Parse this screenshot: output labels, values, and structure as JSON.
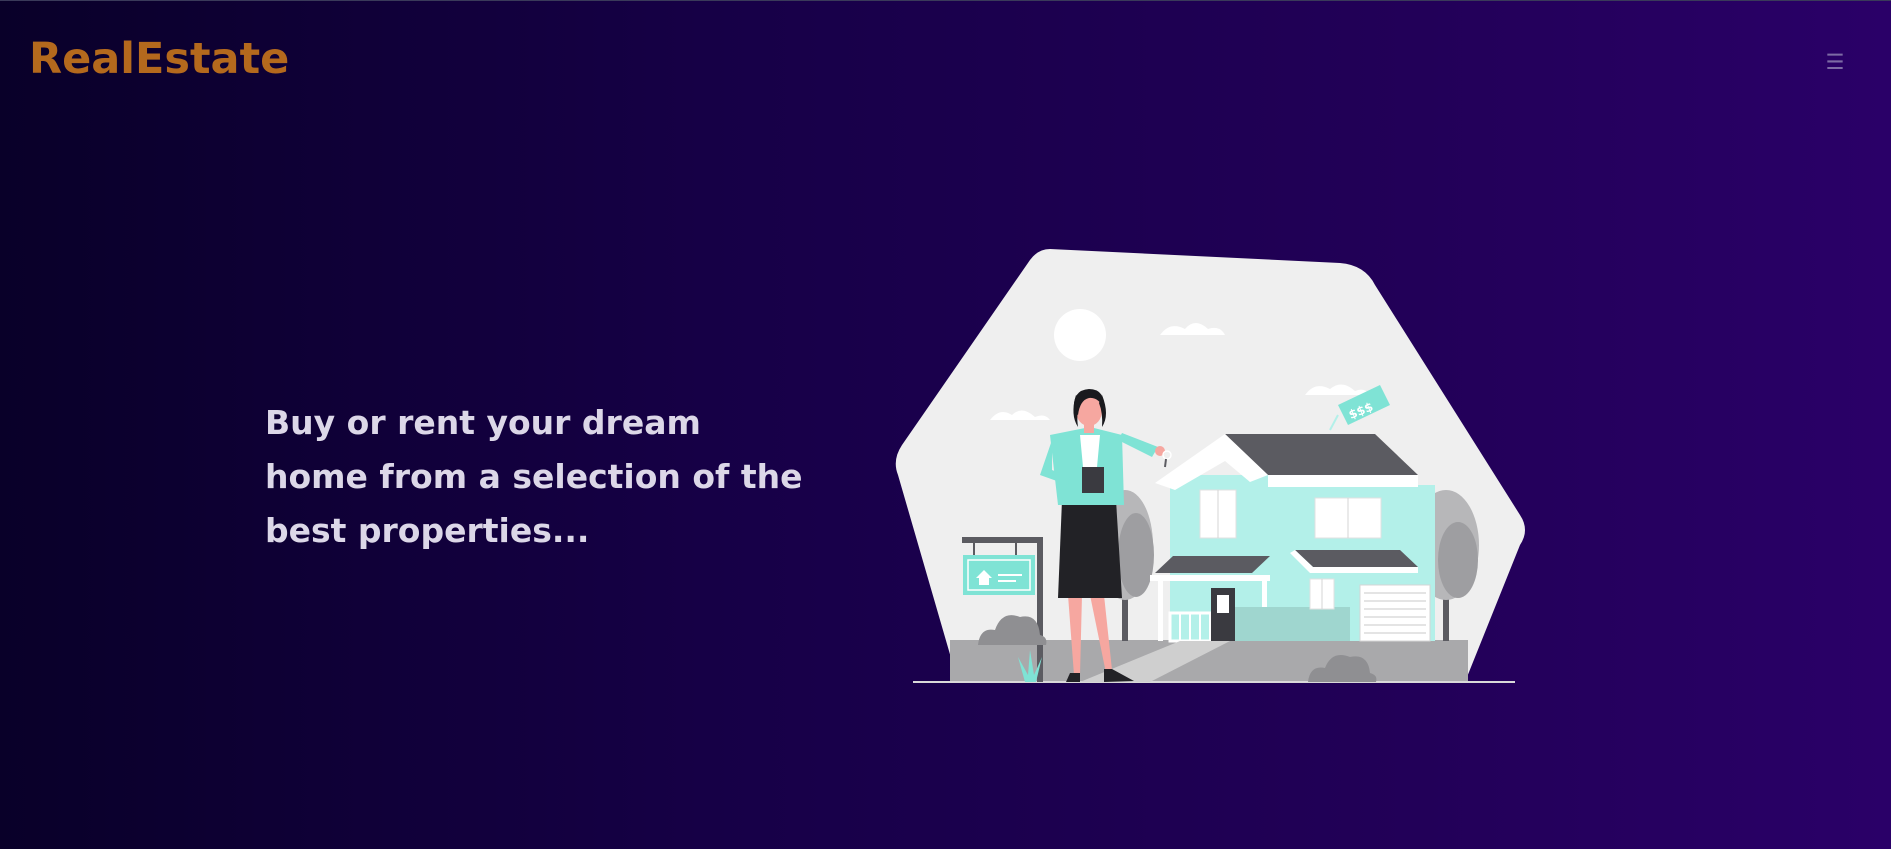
{
  "header": {
    "logo_text": "RealEstate",
    "menu_icon": "hamburger-menu-icon"
  },
  "hero": {
    "headline": "Buy or rent your dream home from a selection of the best properties...",
    "illustration": {
      "description_icon": "real-estate-agent-house-illustration",
      "price_tag_text": "$$$"
    }
  },
  "colors": {
    "background_start": "#090029",
    "background_end": "#2a0068",
    "logo": "#b4691d",
    "headline": "#dcd7e8",
    "accent_teal": "#7fe3d5",
    "blob": "#efefef"
  }
}
